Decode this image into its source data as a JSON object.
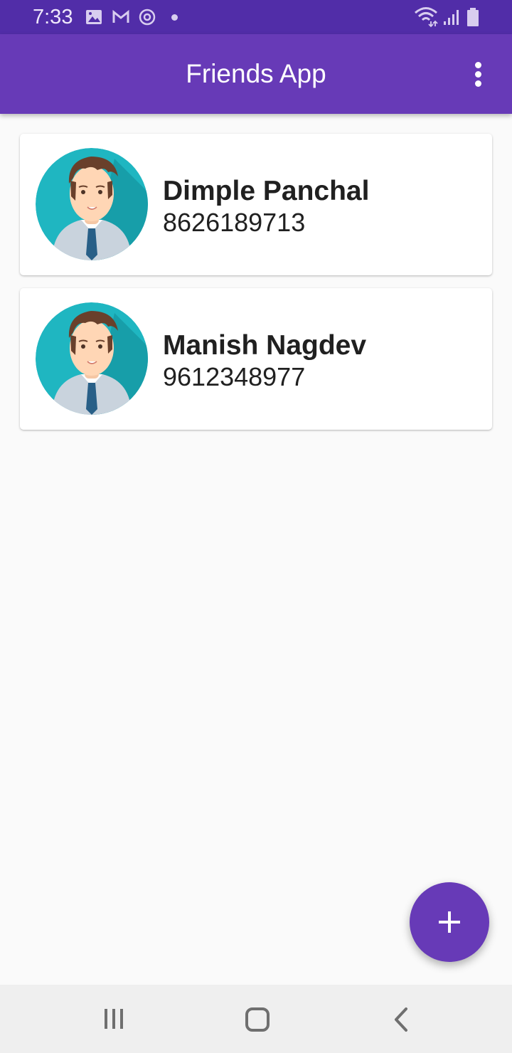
{
  "status_bar": {
    "time": "7:33",
    "left_icons": [
      "image-notification-icon",
      "gmail-icon",
      "sync-circle-icon",
      "notification-dot-icon"
    ],
    "right_icons": [
      "wifi-icon",
      "signal-icon",
      "battery-icon"
    ]
  },
  "app_bar": {
    "title": "Friends App",
    "menu_icon": "overflow-menu-icon",
    "color": "#673ab7"
  },
  "friends": [
    {
      "name": "Dimple Panchal",
      "phone": "8626189713",
      "avatar": "man-avatar-icon"
    },
    {
      "name": "Manish Nagdev",
      "phone": "9612348977",
      "avatar": "man-avatar-icon"
    }
  ],
  "fab": {
    "icon": "plus-icon",
    "color": "#673ab7"
  },
  "navigation_bar": {
    "buttons": [
      "recent-apps-icon",
      "home-icon",
      "back-icon"
    ]
  },
  "colors": {
    "status_bar": "#512da8",
    "background": "#fafafa",
    "avatar_background": "#1fb6c1",
    "text": "#202020"
  }
}
